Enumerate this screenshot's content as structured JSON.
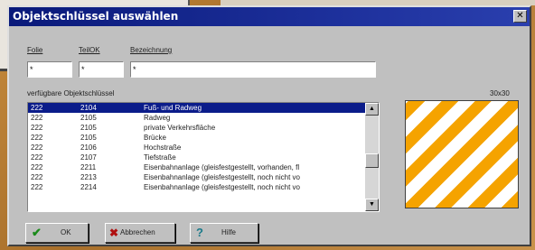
{
  "dialog": {
    "title": "Objektschlüssel auswählen",
    "close_icon": "close-icon",
    "close_glyph": "✕"
  },
  "fields": {
    "folie_label": "Folie",
    "teilok_label": "TeilOK",
    "bezeichnung_label": "Bezeichnung",
    "folie_value": "*",
    "teilok_value": "*",
    "bezeichnung_value": "*"
  },
  "list": {
    "label": "verfügbare Objektschlüssel",
    "rows": [
      {
        "folie": "222",
        "teilok": "2104",
        "text": "Fuß- und Radweg",
        "selected": true
      },
      {
        "folie": "222",
        "teilok": "2105",
        "text": "Radweg",
        "selected": false
      },
      {
        "folie": "222",
        "teilok": "2105",
        "text": "private Verkehrsfläche",
        "selected": false
      },
      {
        "folie": "222",
        "teilok": "2105",
        "text": "Brücke",
        "selected": false
      },
      {
        "folie": "222",
        "teilok": "2106",
        "text": "Hochstraße",
        "selected": false
      },
      {
        "folie": "222",
        "teilok": "2107",
        "text": "Tiefstraße",
        "selected": false
      },
      {
        "folie": "222",
        "teilok": "2211",
        "text": "Eisenbahnanlage (gleisfestgestellt, vorhanden, fl",
        "selected": false
      },
      {
        "folie": "222",
        "teilok": "2213",
        "text": "Eisenbahnanlage (gleisfestgestellt, noch nicht vo",
        "selected": false
      },
      {
        "folie": "222",
        "teilok": "2214",
        "text": "Eisenbahnanlage (gleisfestgestellt, noch nicht vo",
        "selected": false
      }
    ]
  },
  "preview": {
    "size_label": "30x30",
    "pattern_colors": [
      "#f5a300",
      "#ffffff"
    ]
  },
  "buttons": {
    "ok_label": "OK",
    "ok_icon": "checkmark-icon",
    "cancel_label": "Abbrechen",
    "cancel_icon": "x-icon",
    "help_label": "Hilfe",
    "help_icon": "question-mark-icon"
  },
  "colors": {
    "titlebar": "#0a1a7a",
    "selection": "#0b1c8a",
    "ok_icon": "#1a8a1a",
    "cancel_icon": "#b01010",
    "help_icon": "#1a7a8a"
  }
}
